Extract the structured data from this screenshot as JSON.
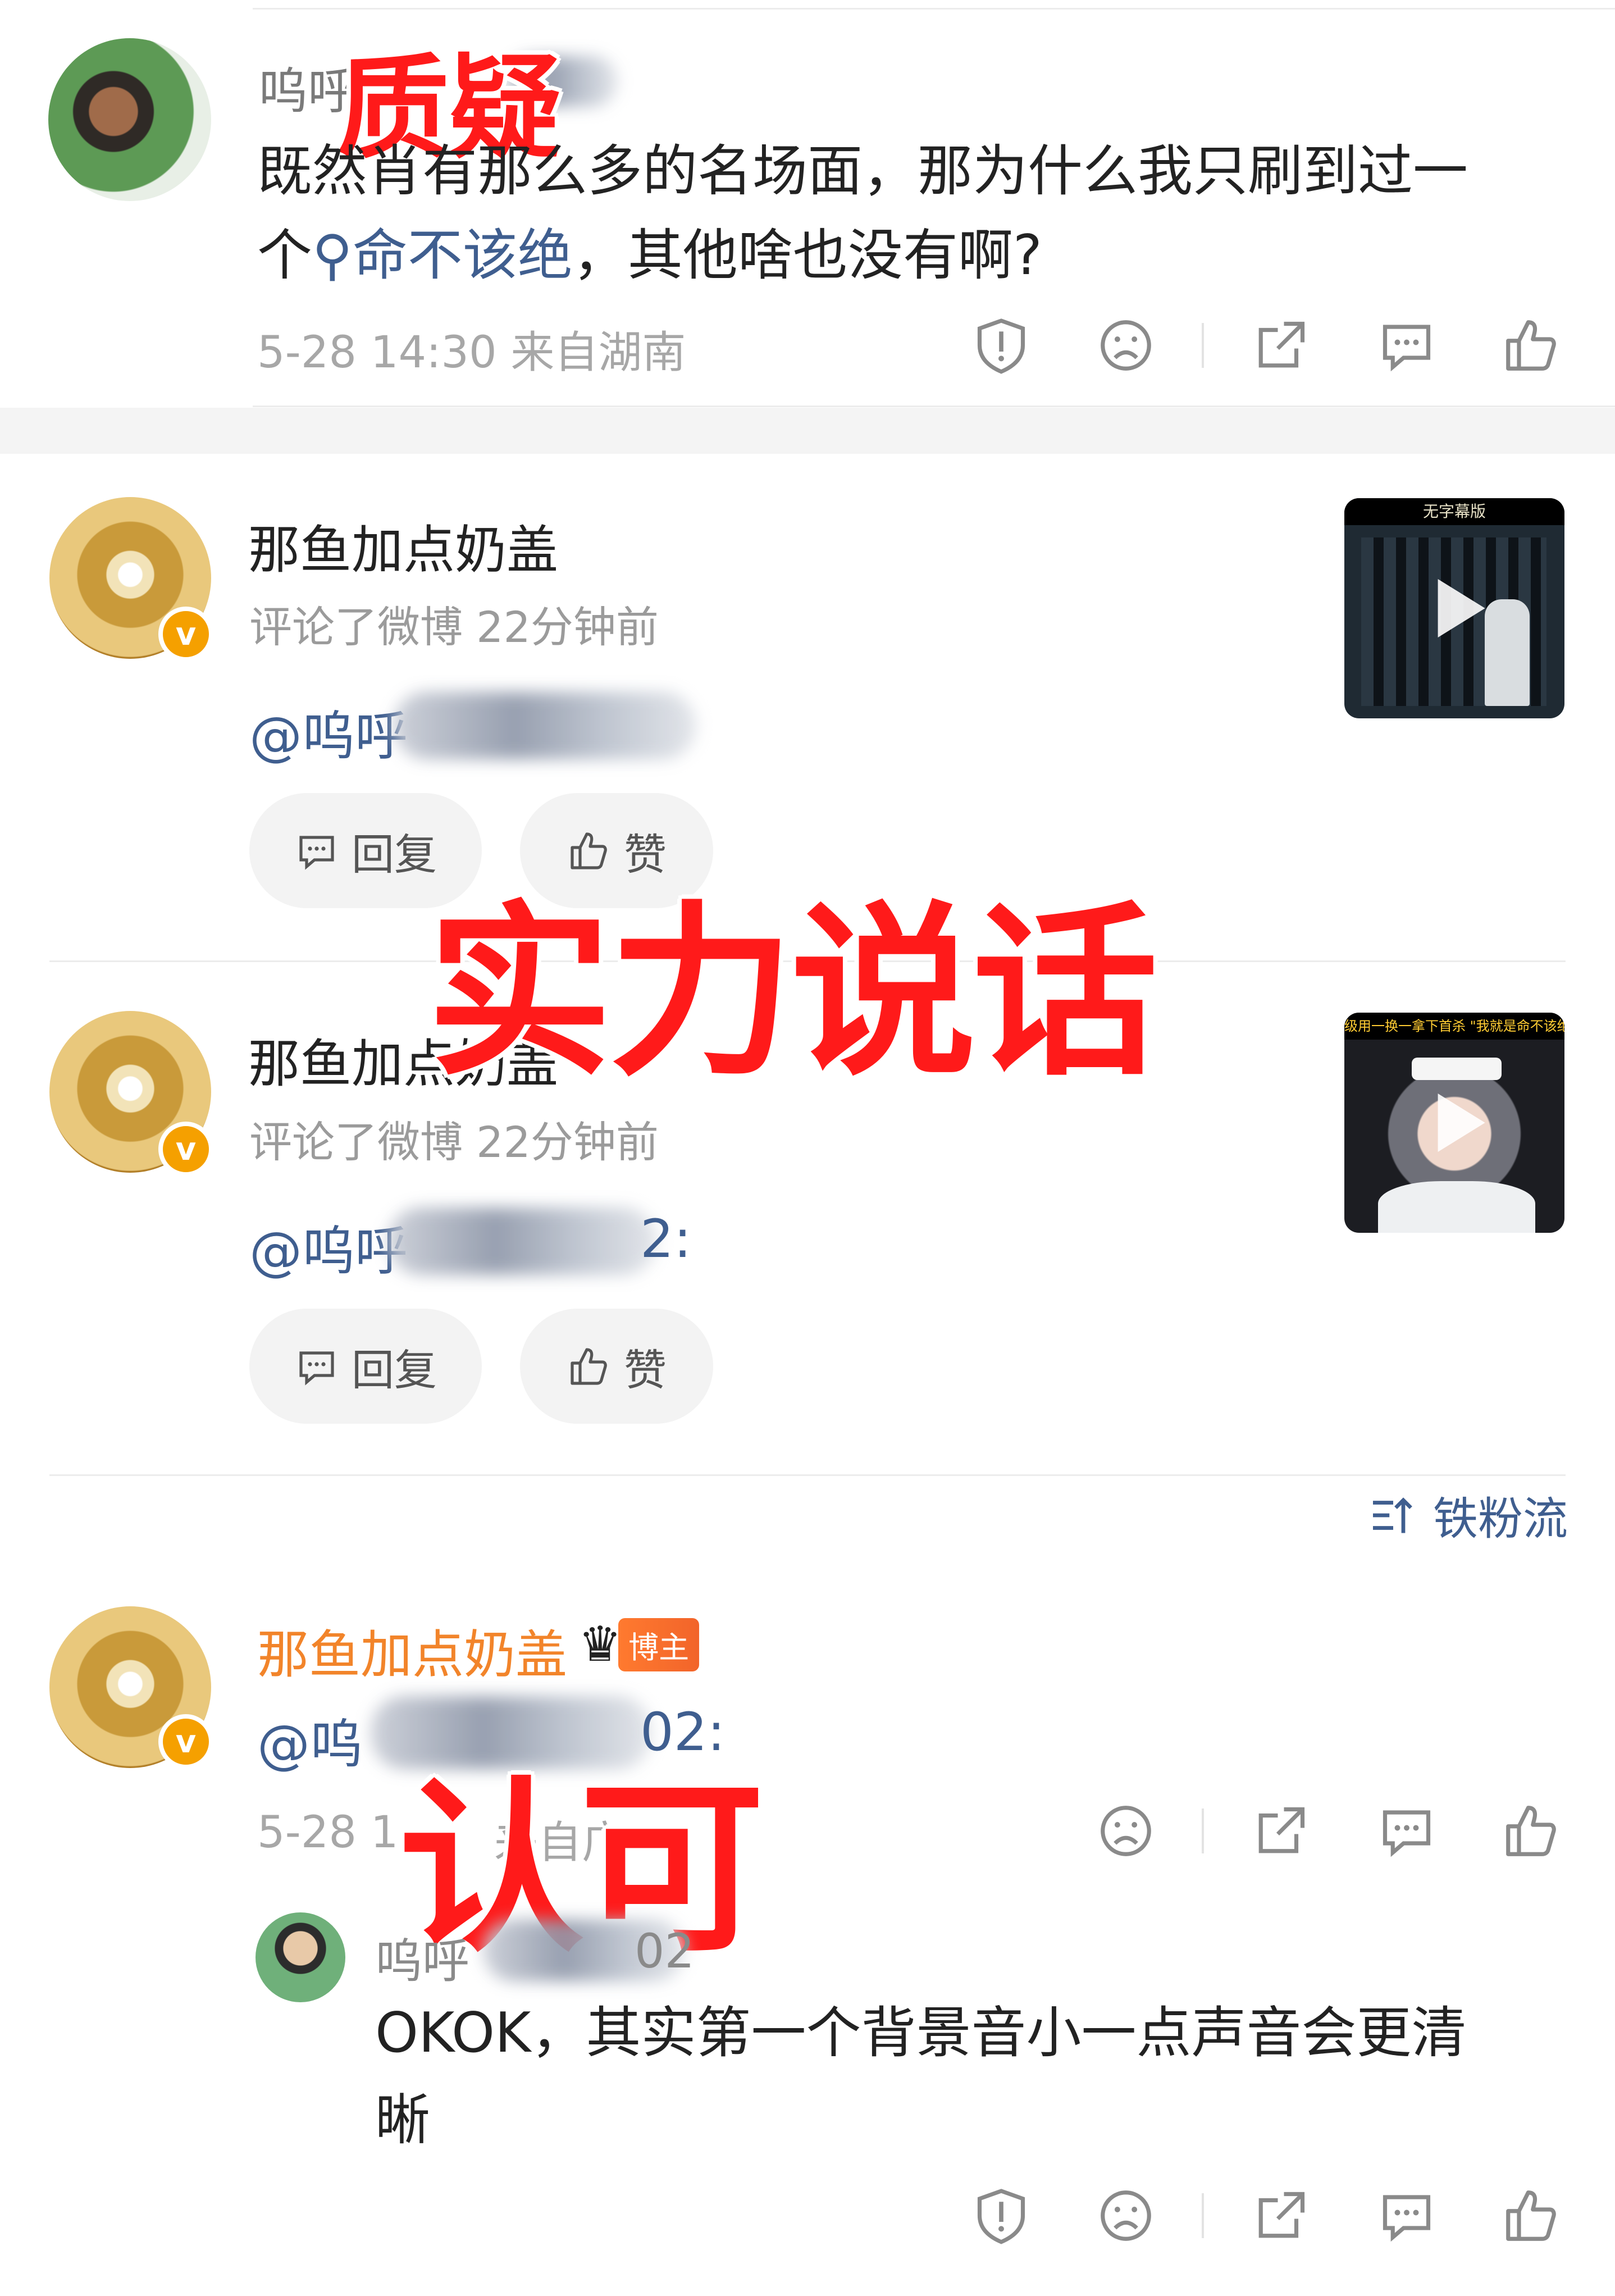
{
  "top_comment": {
    "user_visible": "呜呼",
    "stamp": "质疑",
    "text_line1": "既然肖有那么多的名场面，那为什么我只刷到过一",
    "text_line2_prefix": "个",
    "topic_link": "命不该绝",
    "text_line2_suffix": "，其他啥也没有啊?",
    "meta": "5-28 14:30 来自湖南"
  },
  "feed": [
    {
      "name": "那鱼加点奶盖",
      "sub": "评论了微博   22分钟前",
      "mention": "@呜呼",
      "reply": "回复",
      "like": "赞",
      "thumb_caption": "无字幕版"
    },
    {
      "name": "那鱼加点奶盖",
      "sub": "评论了微博   22分钟前",
      "mention": "@呜呼",
      "mention_tail": "2:",
      "reply": "回复",
      "like": "赞",
      "thumb_caption": "级用一换一拿下首杀 \"我就是命不该绝"
    }
  ],
  "stamp_middle": "实力说话",
  "sort_label": "铁粉流",
  "bottom_comment": {
    "name": "那鱼加点奶盖",
    "badge": "博主",
    "mention": "@呜",
    "mention_tail": "02:",
    "meta_prefix": "5-28 1",
    "meta_suffix": "来自广",
    "stamp": "认可",
    "reply_user": "呜呼",
    "reply_user_tail": "02",
    "reply_line1": "OKOK，其实第一个背景音小一点声音会更清",
    "reply_line2": "晰"
  },
  "colors": {
    "accent_orange": "#f2842a",
    "link_blue": "#3f5e8f",
    "stamp_red": "#ff1a1a",
    "verified": "#f5a000"
  }
}
